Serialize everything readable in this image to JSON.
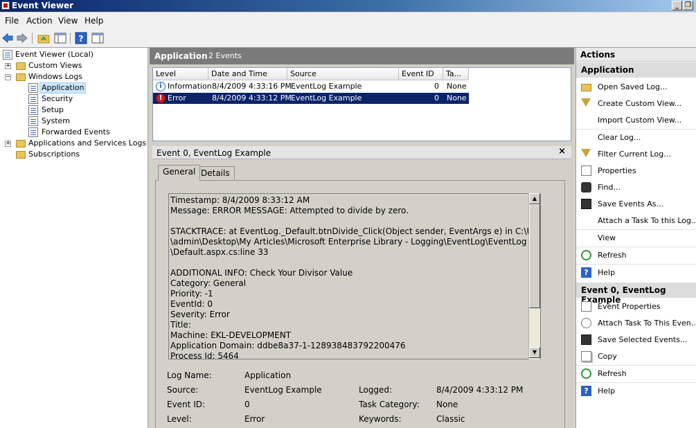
{
  "window": {
    "title": "Event Viewer"
  },
  "menu": [
    "File",
    "Action",
    "View",
    "Help"
  ],
  "tree": {
    "root": "Event Viewer (Local)",
    "custom_views": "Custom Views",
    "windows_logs": "Windows Logs",
    "logs": [
      "Application",
      "Security",
      "Setup",
      "System",
      "Forwarded Events"
    ],
    "apps_services": "Applications and Services Logs",
    "subscriptions": "Subscriptions"
  },
  "center": {
    "title": "Application",
    "count": "2 Events",
    "columns": [
      "Level",
      "Date and Time",
      "Source",
      "Event ID",
      "Ta..."
    ],
    "rows": [
      {
        "level": "Information",
        "datetime": "8/4/2009 4:33:16 PM",
        "source": "EventLog Example",
        "event_id": "0",
        "task": "None"
      },
      {
        "level": "Error",
        "datetime": "8/4/2009 4:33:12 PM",
        "source": "EventLog Example",
        "event_id": "0",
        "task": "None"
      }
    ]
  },
  "detail": {
    "title": "Event 0, EventLog Example",
    "close": "×",
    "tabs": [
      "General",
      "Details"
    ],
    "message_lines": [
      "Timestamp: 8/4/2009 8:33:12 AM",
      "Message: ERROR MESSAGE: Attempted to divide by zero.",
      "",
      "STACKTRACE:    at EventLog._Default.btnDivide_Click(Object sender, EventArgs e) in C:\\Users",
      "\\admin\\Desktop\\My Articles\\Microsoft Enterprise Library - Logging\\EventLog\\EventLog",
      "\\Default.aspx.cs:line 33",
      "",
      "ADDITIONAL INFO: Check Your Divisor Value",
      "Category: General",
      "Priority: -1",
      "EventId: 0",
      "Severity: Error",
      "Title:",
      "Machine: EKL-DEVELOPMENT",
      "Application Domain: ddbe8a37-1-128938483792200476",
      "Process Id: 5464"
    ],
    "props": {
      "log_name_label": "Log Name:",
      "log_name": "Application",
      "source_label": "Source:",
      "source": "EventLog Example",
      "logged_label": "Logged:",
      "logged": "8/4/2009 4:33:12 PM",
      "event_id_label": "Event ID:",
      "event_id": "0",
      "task_label": "Task Category:",
      "task": "None",
      "level_label": "Level:",
      "level": "Error",
      "keywords_label": "Keywords:",
      "keywords": "Classic"
    }
  },
  "actions": {
    "title": "Actions",
    "section1": "Application",
    "items1": [
      "Open Saved Log...",
      "Create Custom View...",
      "Import Custom View...",
      "Clear Log...",
      "Filter Current Log...",
      "Properties",
      "Find...",
      "Save Events As...",
      "Attach a Task To this Log...",
      "View",
      "Refresh",
      "Help"
    ],
    "section2": "Event 0, EventLog Example",
    "items2": [
      "Event Properties",
      "Attach Task To This Even...",
      "Save Selected Events...",
      "Copy",
      "Refresh",
      "Help"
    ]
  }
}
